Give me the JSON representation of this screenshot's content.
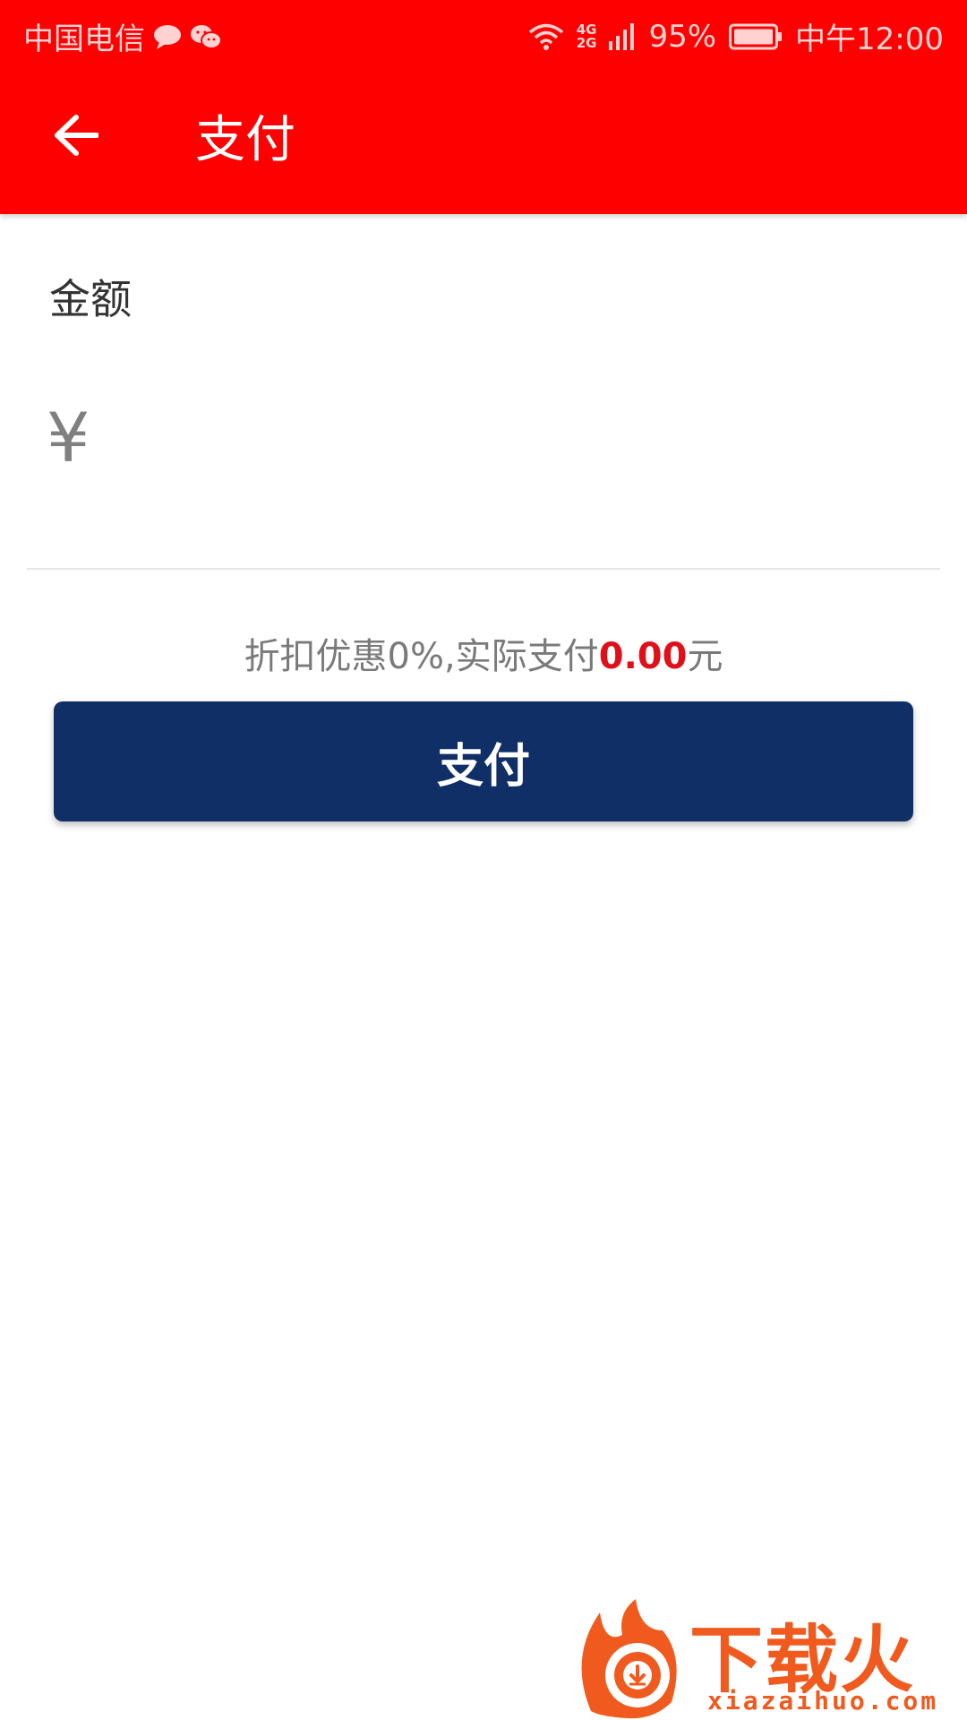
{
  "status_bar": {
    "carrier": "中国电信",
    "network": [
      "4G",
      "2G"
    ],
    "battery_percent": "95%",
    "time": "中午12:00",
    "icons": [
      "message-bubble-icon",
      "wechat-icon",
      "wifi-icon",
      "signal-icon",
      "battery-icon"
    ]
  },
  "toolbar": {
    "title": "支付",
    "back_icon": "arrow-left-icon"
  },
  "form": {
    "amount_label": "金额",
    "currency_symbol": "¥",
    "amount_value": ""
  },
  "discount": {
    "prefix": "折扣优惠0%,实际支付",
    "amount": "0.00",
    "suffix": "元"
  },
  "pay_button": {
    "label": "支付"
  },
  "watermark": {
    "text": "下载火",
    "url": "xiazaihuo.com"
  },
  "colors": {
    "header_bg": "#ff0000",
    "button_bg": "#102f66",
    "accent_red": "#e0101b",
    "watermark_orange": "#f05a1e"
  }
}
